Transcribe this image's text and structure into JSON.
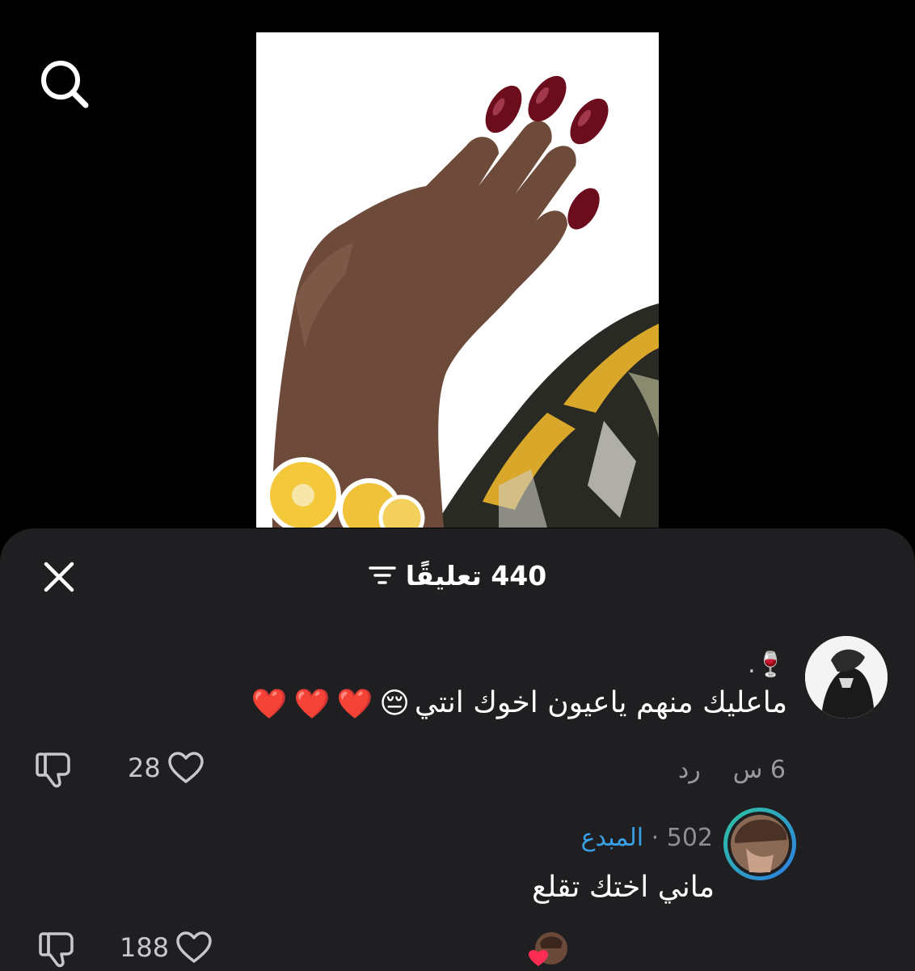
{
  "header": {
    "comment_count": "440 تعليقًا"
  },
  "comments": [
    {
      "author": "🍷.",
      "text": "ماعليك منهم ياعيون اخوك انتي",
      "emojis": [
        "😔",
        "❤️",
        "❤️",
        "❤️"
      ],
      "time": "6 س",
      "reply_label": "رد",
      "likes": "28"
    },
    {
      "score": "502",
      "separator": "·",
      "author": "المبدع",
      "text": "ماني اختك تقلع",
      "likes": "188"
    }
  ],
  "colors": {
    "sheet_bg": "#1f1f21",
    "accent_name": "#3aa0e6",
    "avatar_ring_start": "#2ec4a0",
    "avatar_ring_end": "#2e7de6"
  }
}
